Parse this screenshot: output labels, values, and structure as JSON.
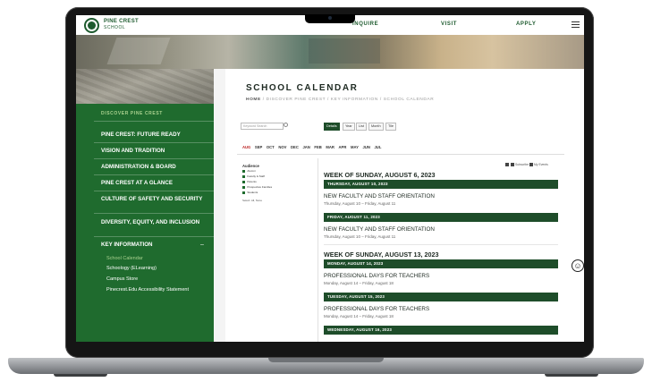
{
  "header": {
    "school_name": "PINE CREST",
    "school_sub": "SCHOOL",
    "nav": [
      "INQUIRE",
      "VISIT",
      "APPLY"
    ]
  },
  "sidebar": {
    "heading": "DISCOVER PINE CREST",
    "items": [
      "PINE CREST: FUTURE READY",
      "VISION AND TRADITION",
      "ADMINISTRATION & BOARD",
      "PINE CREST AT A GLANCE",
      "CULTURE OF SAFETY AND SECURITY",
      "DIVERSITY, EQUITY, AND INCLUSION",
      "KEY INFORMATION"
    ],
    "expand_symbol": "–",
    "subitems": [
      "School Calendar",
      "Schoology (ELearning)",
      "Campus Store",
      "Pinecrest.Edu Accessibility Statement"
    ]
  },
  "page": {
    "title": "SCHOOL CALENDAR",
    "breadcrumb_home": "HOME",
    "breadcrumb_rest": " / DISCOVER PINE CREST / KEY INFORMATION / SCHOOL CALENDAR"
  },
  "calendar": {
    "search_placeholder": "Keyword Search",
    "views": [
      "Details",
      "Year",
      "List",
      "Month",
      "Tile"
    ],
    "months": [
      "AUG",
      "SEP",
      "OCT",
      "NOV",
      "DEC",
      "JAN",
      "FEB",
      "MAR",
      "APR",
      "MAY",
      "JUN",
      "JUL"
    ],
    "audience_title": "Audience",
    "audience": [
      "Alumni",
      "Faculty & Staff",
      "Parents",
      "Prospective Families",
      "Students"
    ],
    "audience_select": "Select: All, None",
    "subscribe": "Subscribe",
    "my_events": "My Events",
    "weeks": [
      {
        "title": "WEEK OF SUNDAY, AUGUST 6, 2023",
        "days": [
          {
            "header": "THURSDAY, AUGUST 10, 2023",
            "event": "NEW FACULTY AND STAFF ORIENTATION",
            "dates": "Thursday, August 10 – Friday, August 11"
          },
          {
            "header": "FRIDAY, AUGUST 11, 2023",
            "event": "NEW FACULTY AND STAFF ORIENTATION",
            "dates": "Thursday, August 10 – Friday, August 11"
          }
        ]
      },
      {
        "title": "WEEK OF SUNDAY, AUGUST 13, 2023",
        "days": [
          {
            "header": "MONDAY, AUGUST 14, 2023",
            "event": "PROFESSIONAL DAYS FOR TEACHERS",
            "dates": "Monday, August 14 – Friday, August 18"
          },
          {
            "header": "TUESDAY, AUGUST 15, 2023",
            "event": "PROFESSIONAL DAYS FOR TEACHERS",
            "dates": "Monday, August 14 – Friday, August 18"
          },
          {
            "header": "WEDNESDAY, AUGUST 16, 2023",
            "event": "",
            "dates": ""
          }
        ]
      }
    ]
  },
  "accessibility_icon": "accessibility-icon",
  "colors": {
    "brand_green": "#1f6b2e",
    "dark_green": "#1e4d2a",
    "accent_light": "#a9d18e"
  }
}
